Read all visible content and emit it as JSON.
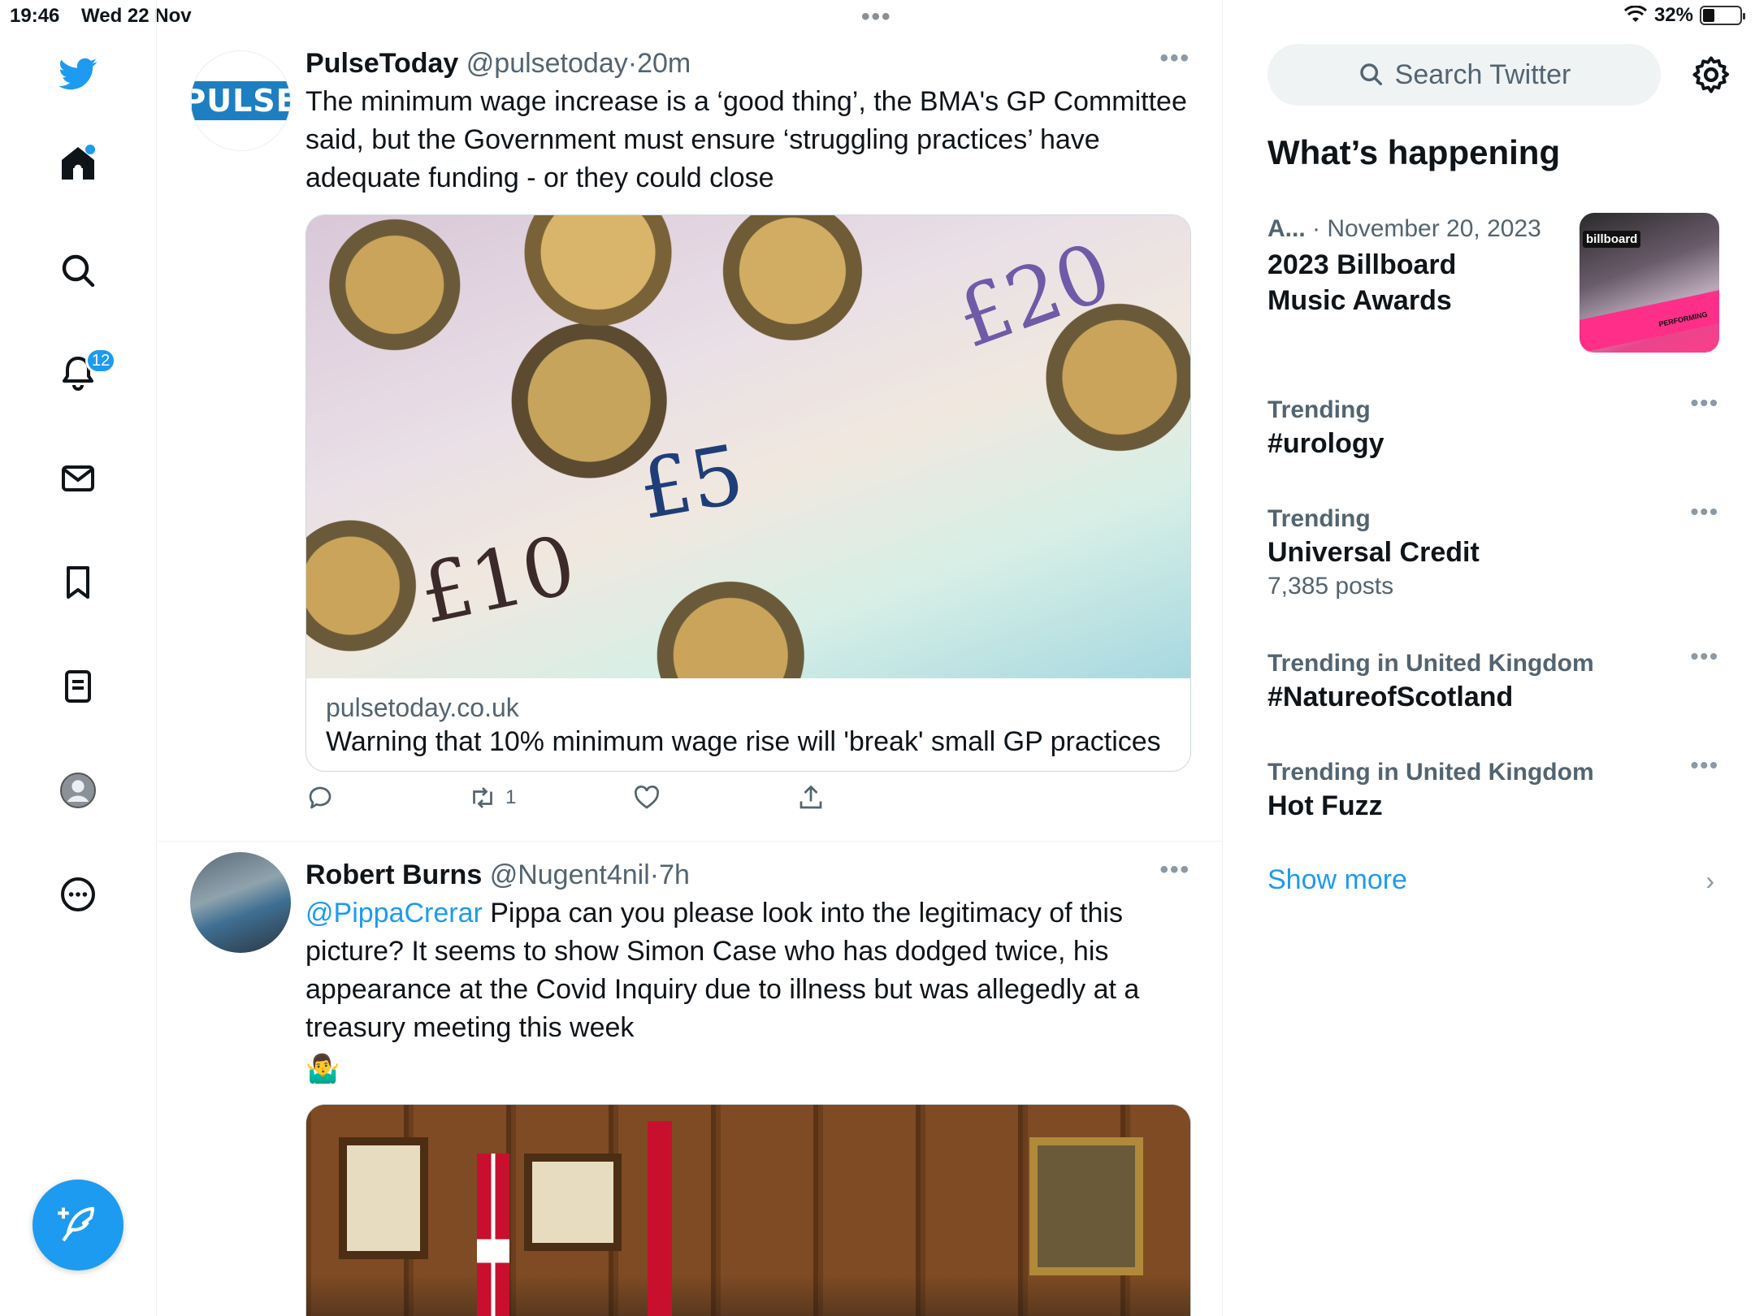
{
  "status_bar": {
    "time": "19:46",
    "date": "Wed 22 Nov",
    "battery": "32%",
    "battery_level_percent": 32
  },
  "nav": {
    "items": [
      {
        "icon": "twitter-logo-icon"
      },
      {
        "icon": "home-icon",
        "has_dot": true
      },
      {
        "icon": "search-icon"
      },
      {
        "icon": "notifications-icon",
        "badge": "12"
      },
      {
        "icon": "messages-icon"
      },
      {
        "icon": "bookmarks-icon"
      },
      {
        "icon": "lists-icon"
      },
      {
        "icon": "profile-icon"
      },
      {
        "icon": "more-icon"
      }
    ],
    "compose_icon": "compose-icon"
  },
  "feed": {
    "tweets": [
      {
        "display_name": "PulseToday",
        "handle": "@pulsetoday",
        "separator": "·",
        "time": "20m",
        "avatar_text": "PULSE",
        "text": "The minimum wage increase is a ‘good thing’, the BMA's GP Committee said, but the Government must ensure ‘struggling practices’ have adequate funding - or they could close",
        "card": {
          "domain": "pulsetoday.co.uk",
          "title": "Warning that 10% minimum wage rise will 'break' small GP practices"
        },
        "actions": {
          "reply_count": "",
          "retweet_count": "1",
          "like_count": "",
          "share": ""
        }
      },
      {
        "display_name": "Robert Burns",
        "handle": "@Nugent4nil",
        "separator": "·",
        "time": "7h",
        "mention": "@PippaCrerar",
        "text": " Pippa can you please look into the legitimacy of this picture? It seems to show Simon Case who has dodged twice, his appearance at the Covid Inquiry due to illness but was allegedly at a treasury meeting this week",
        "emoji": "🤷‍♂️"
      }
    ]
  },
  "sidebar": {
    "search_placeholder": "Search Twitter",
    "section_title": "What’s happening",
    "event": {
      "category": "A...",
      "date": "· November 20, 2023",
      "title_line1": "2023 Billboard",
      "title_line2": "Music Awards",
      "image_logo": "billboard",
      "image_strip": "PERFORMING"
    },
    "trends": [
      {
        "label": "Trending",
        "name": "#urology",
        "posts": ""
      },
      {
        "label": "Trending",
        "name": "Universal Credit",
        "posts": "7,385 posts"
      },
      {
        "label": "Trending in United Kingdom",
        "name": "#NatureofScotland",
        "posts": ""
      },
      {
        "label": "Trending in United Kingdom",
        "name": "Hot Fuzz",
        "posts": ""
      }
    ],
    "show_more": "Show more"
  },
  "colors": {
    "accent": "#1d9bf0",
    "text_primary": "#0f1419",
    "text_secondary": "#536471",
    "border": "#eff3f4"
  }
}
